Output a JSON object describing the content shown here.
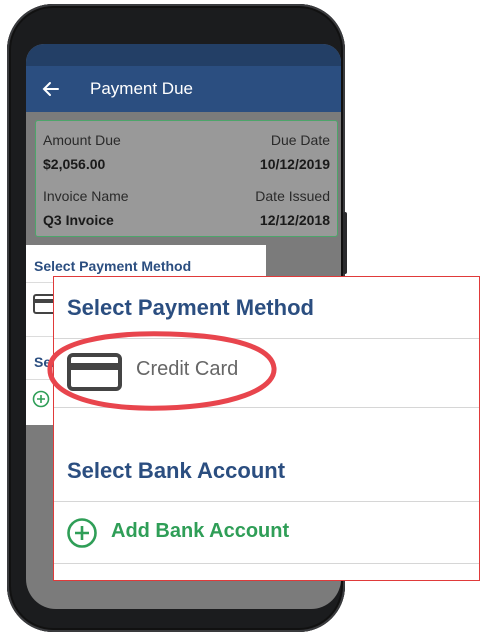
{
  "header": {
    "title": "Payment Due"
  },
  "summary": {
    "amount_due_label": "Amount Due",
    "amount_due": "$2,056.00",
    "due_date_label": "Due Date",
    "due_date": "10/12/2019",
    "invoice_name_label": "Invoice Name",
    "invoice_name": "Q3 Invoice",
    "date_issued_label": "Date Issued",
    "date_issued": "12/12/2018"
  },
  "background_sheet": {
    "select_payment_title": "Select Payment Method",
    "select_partial": "Sele"
  },
  "zoom": {
    "select_payment_title": "Select Payment Method",
    "credit_card_label": "Credit Card",
    "select_bank_title": "Select Bank Account",
    "add_bank_label": "Add Bank Account"
  },
  "colors": {
    "appbar": "#2b4e80",
    "accent_green": "#2f9e57",
    "highlight_red": "#e03a3a"
  }
}
